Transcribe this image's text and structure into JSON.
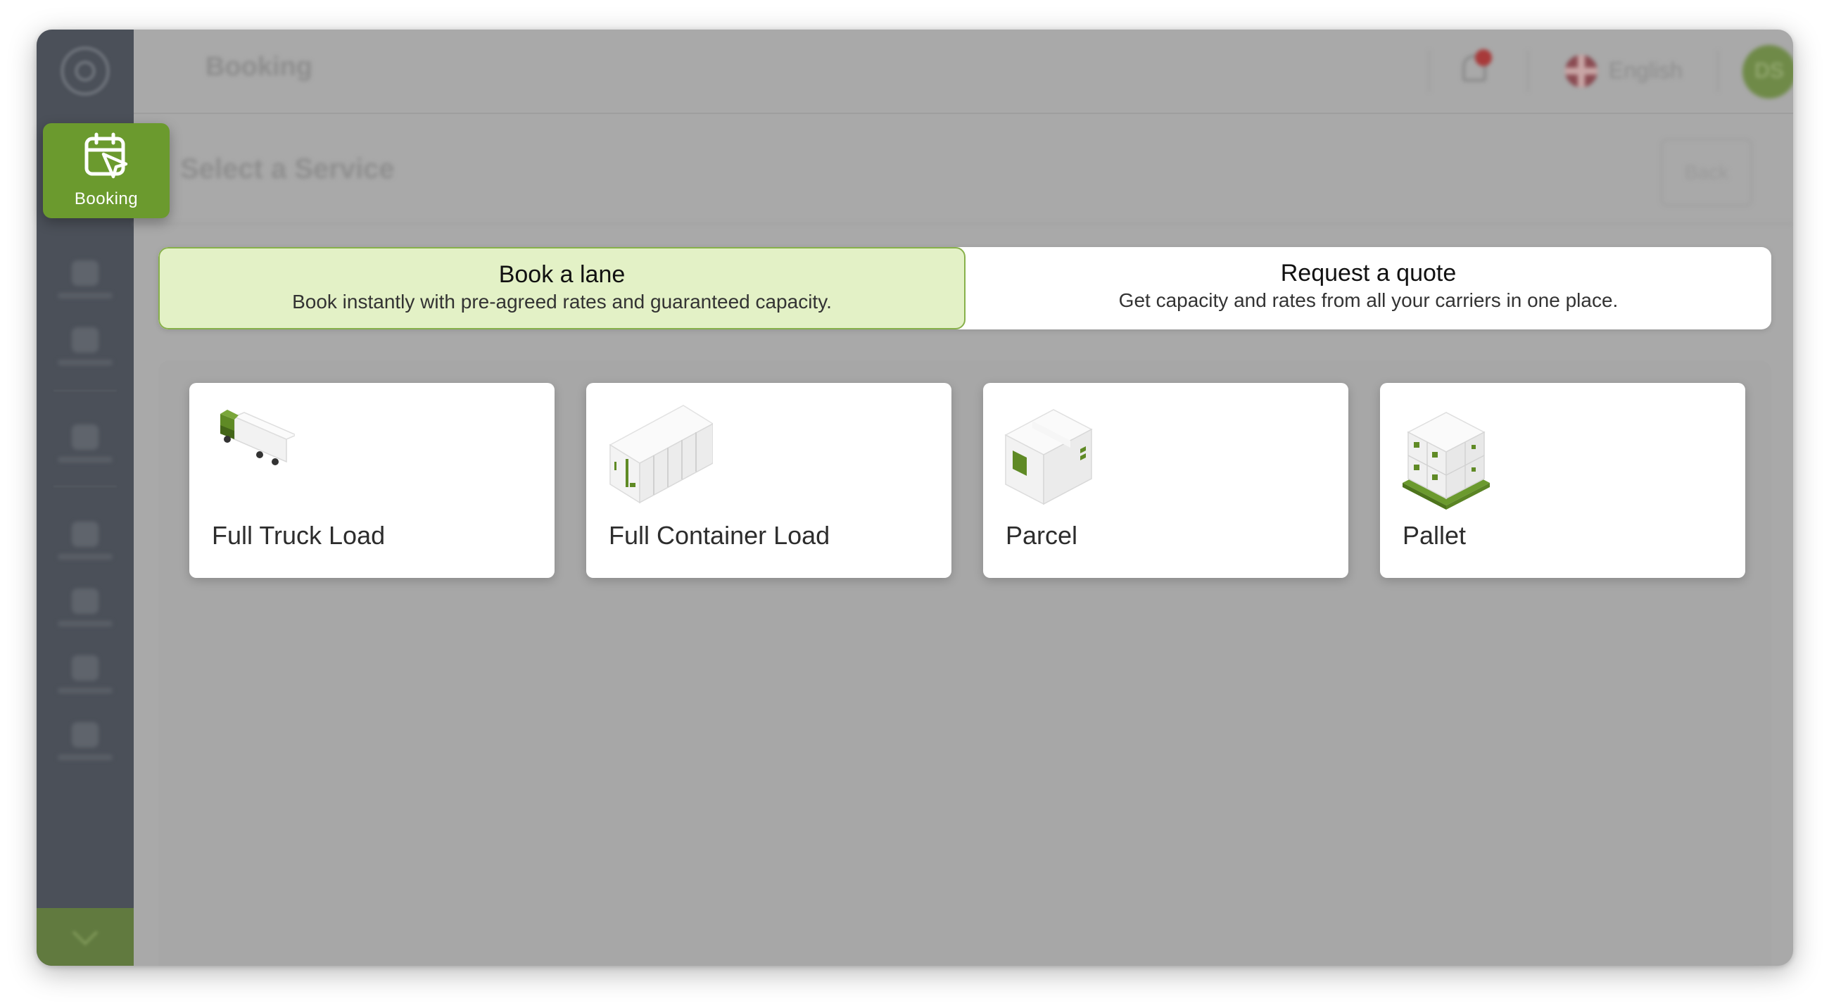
{
  "colors": {
    "brand_green": "#6b9a2e",
    "selected_tab_bg": "#e3f1c6",
    "sidebar_bg": "#4b5059",
    "overlay_gray": "#a9a9a9"
  },
  "header": {
    "title": "Booking",
    "notification_count": "1",
    "language": "English",
    "avatar_initials": "DS"
  },
  "page": {
    "subtitle": "Select a Service",
    "back_label": "Back"
  },
  "sidebar": {
    "active_item": {
      "label": "Booking",
      "icon": "calendar-pointer-icon"
    },
    "items": [
      {
        "icon": "home-icon"
      },
      {
        "icon": "chart-icon"
      },
      {
        "icon": "trips-icon"
      },
      {
        "icon": "document-icon"
      },
      {
        "icon": "file-icon"
      },
      {
        "icon": "book-icon"
      },
      {
        "icon": "settings-icon"
      }
    ]
  },
  "tabs": [
    {
      "title": "Book a lane",
      "description": "Book instantly with pre-agreed rates and guaranteed capacity.",
      "selected": true
    },
    {
      "title": "Request a quote",
      "description": "Get capacity and rates from all your carriers in one place.",
      "selected": false
    }
  ],
  "services": [
    {
      "label": "Full Truck Load",
      "icon": "truck-icon"
    },
    {
      "label": "Full Container Load",
      "icon": "container-icon"
    },
    {
      "label": "Parcel",
      "icon": "parcel-box-icon"
    },
    {
      "label": "Pallet",
      "icon": "pallet-icon"
    }
  ]
}
